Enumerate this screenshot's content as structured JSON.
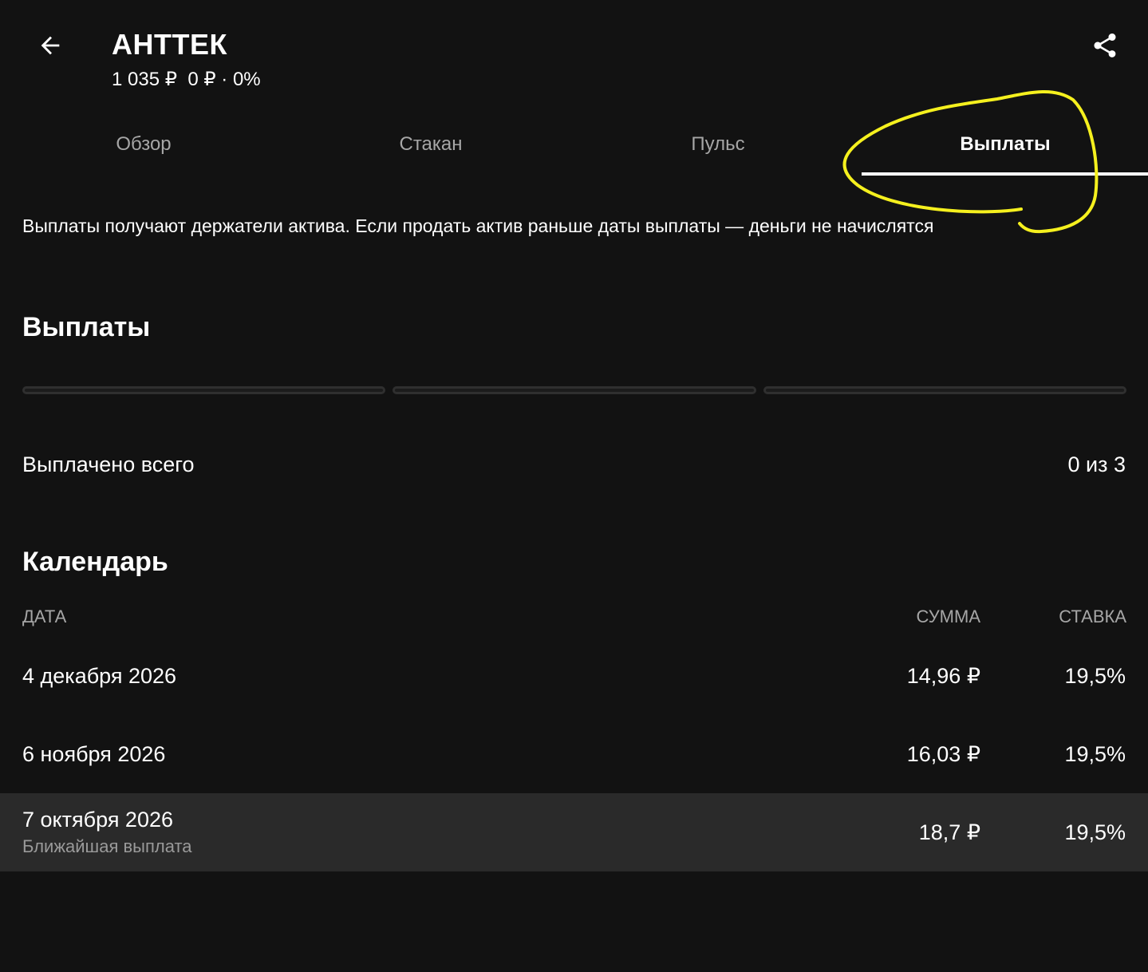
{
  "header": {
    "back_icon": "arrow-left-icon",
    "title": "АНТТЕК",
    "price": "1 035 ₽",
    "change": "0 ₽ · 0%",
    "share_icon": "share-icon"
  },
  "tabs": [
    {
      "label": "Обзор",
      "active": false
    },
    {
      "label": "Стакан",
      "active": false
    },
    {
      "label": "Пульс",
      "active": false
    },
    {
      "label": "Выплаты",
      "active": true
    }
  ],
  "info_text": "Выплаты получают держатели актива. Если продать актив раньше даты выплаты — деньги не начислятся",
  "payouts": {
    "title": "Выплаты",
    "progress_segments": 3,
    "progress_filled": 0,
    "paid_total_label": "Выплачено всего",
    "paid_total_value": "0 из 3"
  },
  "calendar": {
    "title": "Календарь",
    "columns": {
      "date": "ДАТА",
      "amount": "СУММА",
      "rate": "СТАВКА"
    },
    "rows": [
      {
        "date": "4 декабря 2026",
        "amount": "14,96 ₽",
        "rate": "19,5%",
        "note": ""
      },
      {
        "date": "6 ноября 2026",
        "amount": "16,03 ₽",
        "rate": "19,5%",
        "note": ""
      },
      {
        "date": "7 октября 2026",
        "amount": "18,7 ₽",
        "rate": "19,5%",
        "note": "Ближайшая выплата"
      }
    ]
  },
  "colors": {
    "background": "#121212",
    "highlight_row": "#2a2a2a",
    "annotation": "#f5f01e",
    "muted_text": "#a6a6a6"
  }
}
